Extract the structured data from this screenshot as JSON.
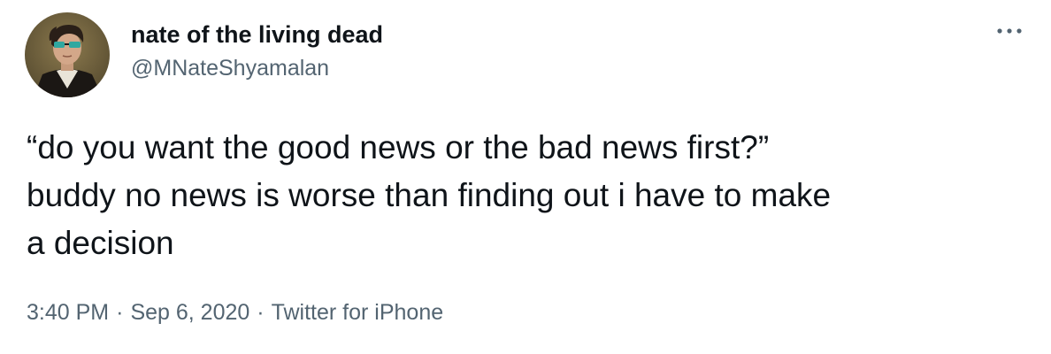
{
  "author": {
    "display_name": "nate of the living dead",
    "handle": "@MNateShyamalan",
    "avatar_icon": "portrait-avatar-icon"
  },
  "menu": {
    "icon": "more-options-icon"
  },
  "tweet": {
    "lines": [
      "“do you want the good news or the bad news first?”",
      "buddy no news is worse than finding out i have to make",
      "a decision"
    ]
  },
  "meta": {
    "time": "3:40 PM",
    "separator": "·",
    "date": "Sep 6, 2020",
    "source": "Twitter for iPhone"
  },
  "colors": {
    "text_primary": "#0f1419",
    "text_secondary": "#536471",
    "background": "#ffffff"
  }
}
